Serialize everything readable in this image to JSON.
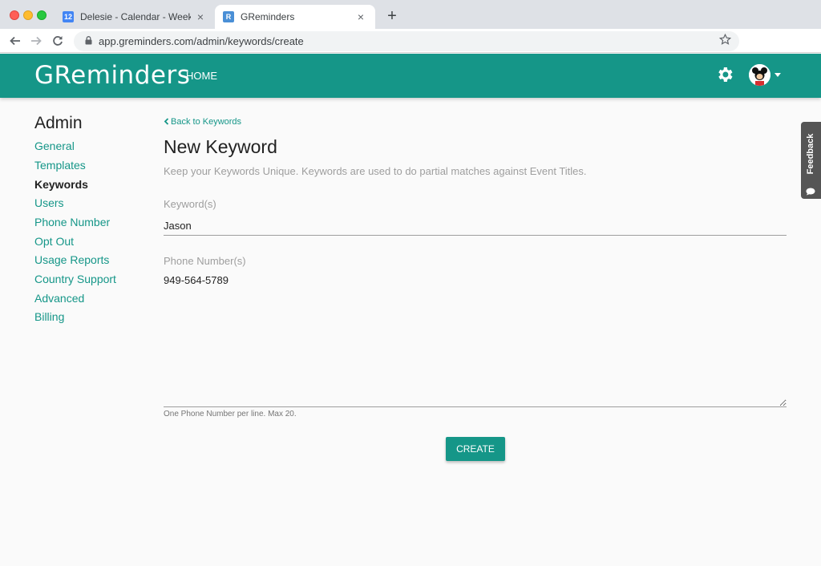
{
  "browser": {
    "tabs": [
      {
        "title": "Delesie - Calendar - Week of Ma",
        "favicon": "calendar-favicon",
        "favicon_text": "12",
        "active": false
      },
      {
        "title": "GReminders",
        "favicon": "greminders-favicon",
        "favicon_text": "R",
        "active": true
      }
    ],
    "close_glyph": "×",
    "new_tab_glyph": "+",
    "url": "app.greminders.com/admin/keywords/create"
  },
  "header": {
    "brand": "GReminders",
    "nav_home": "HOME",
    "accent_color": "#159688"
  },
  "sidebar": {
    "title": "Admin",
    "items": [
      {
        "label": "General",
        "active": false
      },
      {
        "label": "Templates",
        "active": false
      },
      {
        "label": "Keywords",
        "active": true
      },
      {
        "label": "Users",
        "active": false
      },
      {
        "label": "Phone Number",
        "active": false
      },
      {
        "label": "Opt Out",
        "active": false
      },
      {
        "label": "Usage Reports",
        "active": false
      },
      {
        "label": "Country Support",
        "active": false
      },
      {
        "label": "Advanced",
        "active": false
      },
      {
        "label": "Billing",
        "active": false
      }
    ]
  },
  "main": {
    "back_link": "Back to Keywords",
    "title": "New Keyword",
    "description": "Keep your Keywords Unique. Keywords are used to do partial matches against Event Titles.",
    "keyword_label": "Keyword(s)",
    "keyword_value": "Jason",
    "phone_label": "Phone Number(s)",
    "phone_value": "949-564-5789",
    "phone_helper": "One Phone Number per line. Max 20.",
    "create_button": "CREATE"
  },
  "feedback": {
    "label": "Feedback"
  }
}
